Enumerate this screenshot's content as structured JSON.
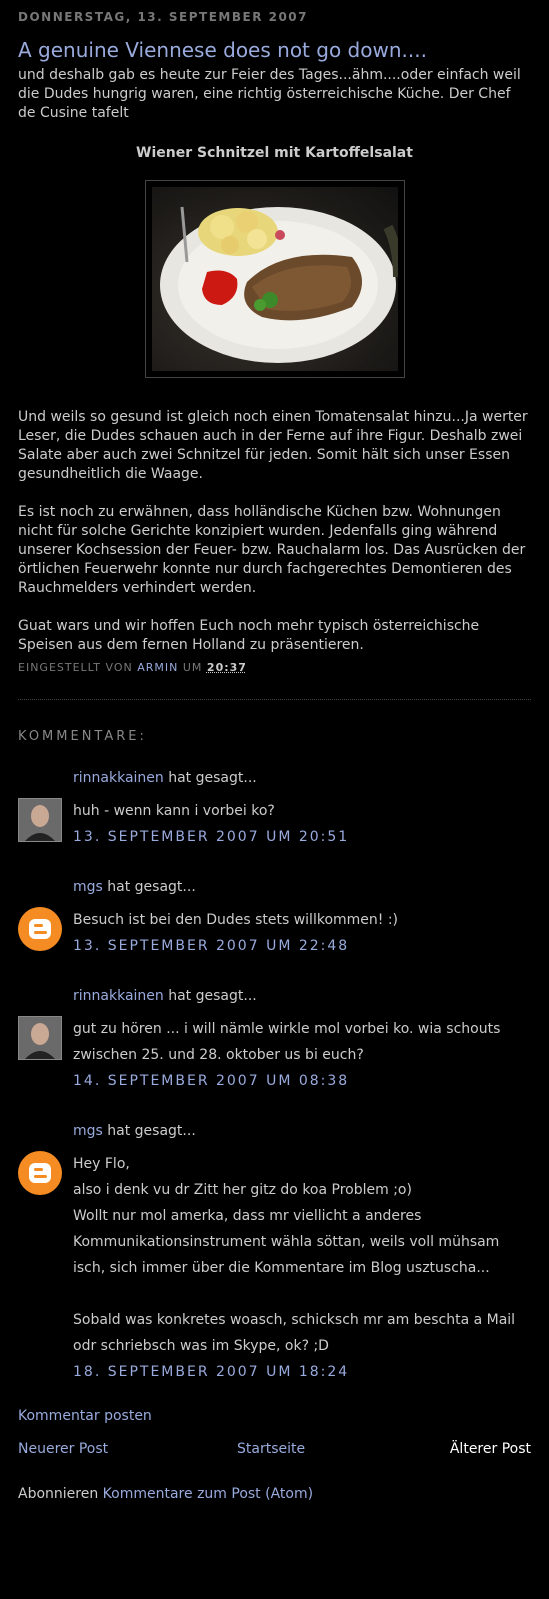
{
  "post": {
    "date_header": "DONNERSTAG, 13. SEPTEMBER 2007",
    "title": "A genuine Viennese does not go down....",
    "intro": "und deshalb gab es heute zur Feier des Tages...ähm....oder einfach weil die Dudes hungrig waren, eine richtig österreichische Küche. Der Chef de Cusine tafelt",
    "caption": "Wiener Schnitzel mit Kartoffelsalat",
    "paragraphs": [
      "Und weils so gesund ist gleich noch einen Tomatensalat hinzu...Ja werter Leser, die Dudes schauen auch in der Ferne auf ihre Figur. Deshalb zwei Salate aber auch zwei Schnitzel für jeden. Somit hält sich unser Essen gesundheitlich die Waage.",
      "Es ist noch zu erwähnen, dass holländische Küchen bzw. Wohnungen nicht für solche Gerichte konzipiert wurden. Jedenfalls ging während unserer Kochsession der Feuer- bzw. Rauchalarm los. Das Ausrücken der örtlichen Feuerwehr konnte nur durch fachgerechtes Demontieren des Rauchmelders verhindert werden.",
      "Guat wars und wir hoffen Euch noch mehr typisch österreichische Speisen aus dem fernen Holland zu präsentieren."
    ],
    "footer_prefix": "EINGESTELLT VON",
    "author": "ARMIN",
    "footer_um": "UM",
    "time": "20:37"
  },
  "comments_header": "KOMMENTARE:",
  "said_suffix": "hat gesagt...",
  "comments": [
    {
      "author": "rinnakkainen",
      "avatar": "photo",
      "lines": [
        "huh - wenn kann i vorbei ko?"
      ],
      "timestamp": "13. SEPTEMBER 2007 UM 20:51"
    },
    {
      "author": "mgs",
      "avatar": "blogger",
      "lines": [
        "Besuch ist bei den Dudes stets willkommen! :)"
      ],
      "timestamp": "13. SEPTEMBER 2007 UM 22:48"
    },
    {
      "author": "rinnakkainen",
      "avatar": "photo",
      "lines": [
        "gut zu hören ... i will nämle wirkle mol vorbei ko. wia schouts zwischen 25. und 28. oktober us bi euch?"
      ],
      "timestamp": "14. SEPTEMBER 2007 UM 08:38"
    },
    {
      "author": "mgs",
      "avatar": "blogger",
      "lines": [
        "Hey Flo,",
        "also i denk vu dr Zitt her gitz do koa Problem ;o)",
        "Wollt nur mol amerka, dass mr viellicht a anderes Kommunikationsinstrument wähla söttan, weils voll mühsam isch, sich immer über die Kommentare im Blog usztuscha...",
        "",
        "Sobald was konkretes woasch, schicksch mr am beschta a Mail odr schriebsch was im Skype, ok? ;D"
      ],
      "timestamp": "18. SEPTEMBER 2007 UM 18:24"
    }
  ],
  "links": {
    "post_comment": "Kommentar posten",
    "newer_post": "Neuerer Post",
    "home": "Startseite",
    "older_post": "Älterer Post",
    "subscribe_label": "Abonnieren",
    "subscribe_link": "Kommentare zum Post (Atom)"
  },
  "icons": {
    "blogger_avatar": "blogger-logo-icon",
    "photo_avatar": "user-photo-icon"
  },
  "colors": {
    "background": "#000000",
    "text": "#cccccc",
    "link": "#99aadd",
    "muted": "#777777",
    "blogger_orange": "#f48c23"
  }
}
